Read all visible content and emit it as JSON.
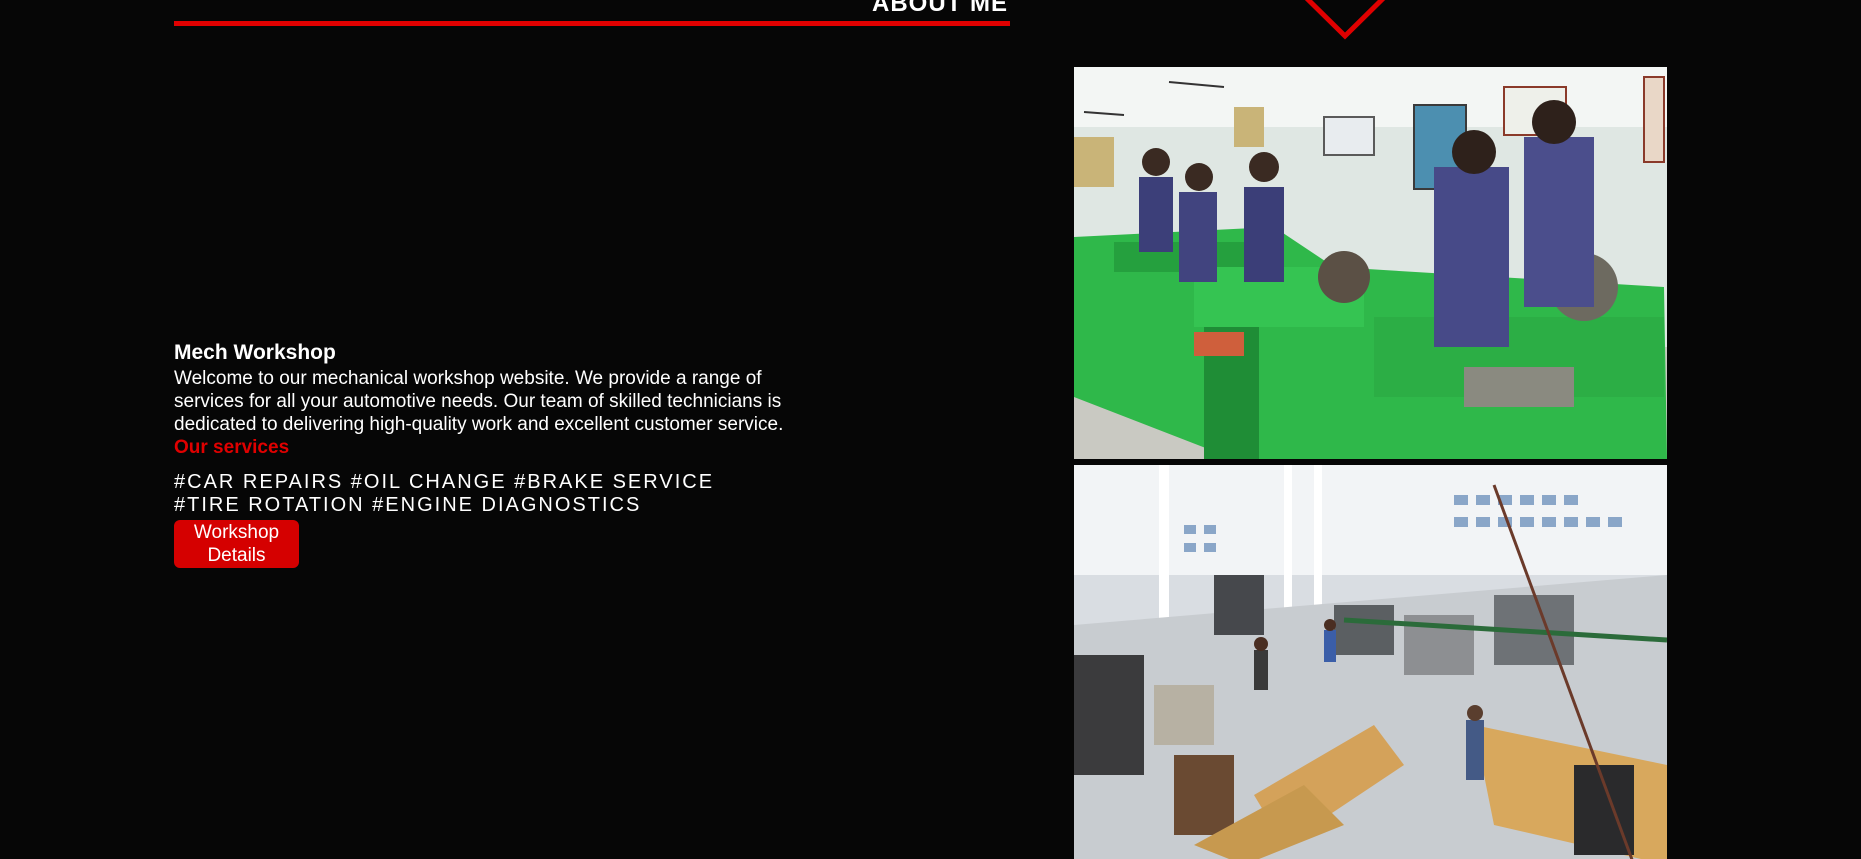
{
  "header": {
    "section_heading": "ABOUT ME"
  },
  "about": {
    "title": "Mech Workshop",
    "description": "Welcome to our mechanical workshop website. We provide a range of services for all your automotive needs. Our team of skilled technicians is dedicated to delivering high-quality work and excellent customer service.",
    "services_label": "Our services",
    "tags": [
      "#CAR REPAIRS",
      "#OIL CHANGE",
      "#BRAKE SERVICE",
      "#TIRE ROTATION",
      "#ENGINE DIAGNOSTICS"
    ],
    "button_label": "Workshop Details"
  },
  "gallery": {
    "photo_1": "workshop-students-lathe-photo",
    "photo_2": "workshop-floor-overview-photo"
  },
  "colors": {
    "background": "#060606",
    "accent": "#e00000",
    "text": "#ffffff",
    "machine_green": "#2fb84a"
  }
}
